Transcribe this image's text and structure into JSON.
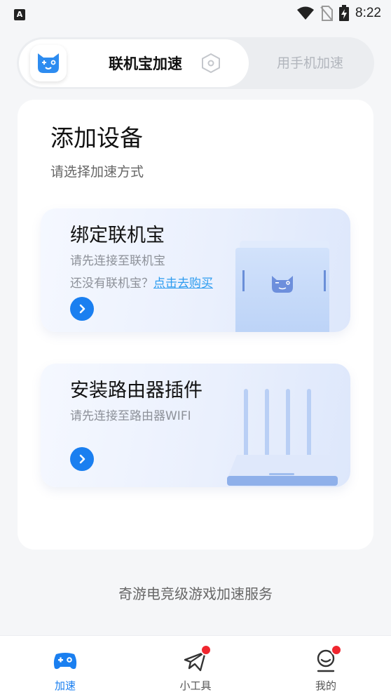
{
  "status_bar": {
    "time": "8:22",
    "left_icon": "A"
  },
  "mode_switch": {
    "active_label": "联机宝加速",
    "inactive_label": "用手机加速"
  },
  "main": {
    "title": "添加设备",
    "subtitle": "请选择加速方式",
    "bind_card": {
      "title": "绑定联机宝",
      "desc": "请先连接至联机宝",
      "no_device_text": "还没有联机宝？",
      "buy_link": "点击去购买"
    },
    "router_card": {
      "title": "安装路由器插件",
      "desc": "请先连接至路由器WIFI"
    }
  },
  "footer": {
    "slogan": "奇游电竞级游戏加速服务"
  },
  "tab_bar": {
    "tabs": [
      {
        "label": "加速",
        "icon": "gamepad-icon",
        "active": true,
        "badge": false
      },
      {
        "label": "小工具",
        "icon": "paper-plane-icon",
        "active": false,
        "badge": true
      },
      {
        "label": "我的",
        "icon": "profile-icon",
        "active": false,
        "badge": true
      }
    ]
  },
  "colors": {
    "accent": "#1a7ff0",
    "link": "#2d9cf0",
    "badge": "#f0262f",
    "background": "#f5f6f8"
  }
}
